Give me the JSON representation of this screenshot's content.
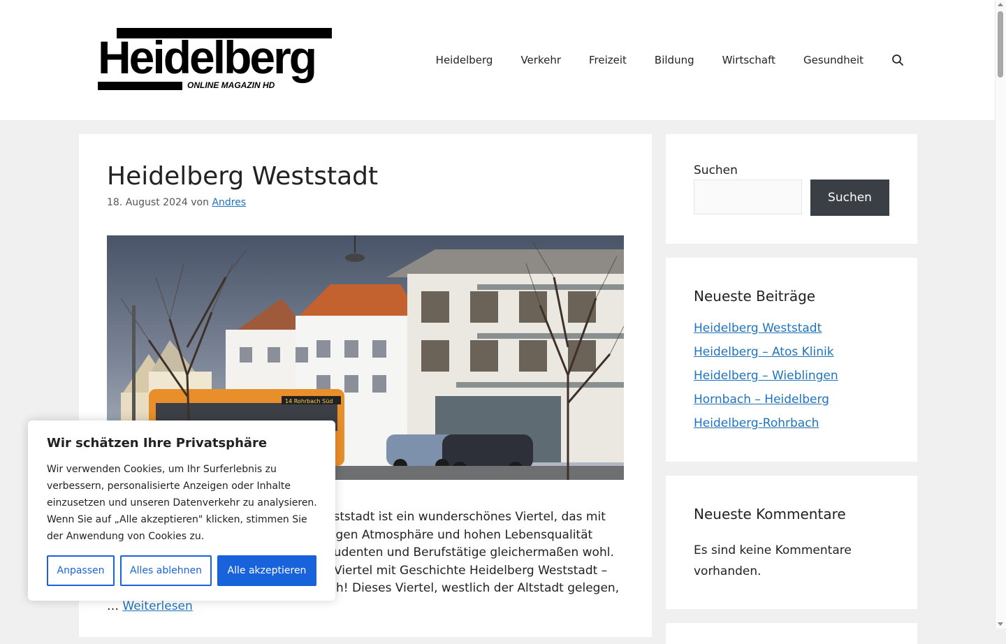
{
  "header": {
    "logo": {
      "word": "Heidelberg",
      "subtitle": "ONLINE MAGAZIN HD"
    },
    "nav": [
      "Heidelberg",
      "Verkehr",
      "Freizeit",
      "Bildung",
      "Wirtschaft",
      "Gesundheit"
    ],
    "search_icon": "search-icon"
  },
  "article": {
    "title": "Heidelberg Weststadt",
    "date": "18. August 2024",
    "by": "von",
    "author": "Andres",
    "excerpt_lines": [
      "eststadt ist ein wunderschönes Viertel, das mit",
      "ligen Atmosphäre und hohen Lebensqualität",
      "tudenten und Berufstätige gleichermaßen wohl.",
      "Viertel mit Geschichte Heidelberg Weststadt –",
      "h! Dieses Viertel, westlich der Altstadt gelegen,"
    ],
    "ellipsis": "…",
    "read_more": "Weiterlesen",
    "image_tram_label": "14 Rohrbach Süd"
  },
  "sidebar": {
    "search": {
      "label": "Suchen",
      "placeholder": "",
      "button": "Suchen"
    },
    "recent_posts": {
      "title": "Neueste Beiträge",
      "items": [
        "Heidelberg Weststadt",
        "Heidelberg – Atos Klinik",
        "Heidelberg – Wieblingen",
        "Hornbach – Heidelberg",
        "Heidelberg-Rohrbach"
      ]
    },
    "recent_comments": {
      "title": "Neueste Kommentare",
      "text": "Es sind keine Kommentare vorhanden."
    }
  },
  "cookie": {
    "title": "Wir schätzen Ihre Privatsphäre",
    "text": "Wir verwenden Cookies, um Ihr Surferlebnis zu verbessern, personalisierte Anzeigen oder Inhalte einzusetzen und unseren Datenverkehr zu analysieren. Wenn Sie auf „Alle akzeptieren\" klicken, stimmen Sie der Anwendung von Cookies zu.",
    "buttons": {
      "customize": "Anpassen",
      "reject": "Alles ablehnen",
      "accept": "Alle akzeptieren"
    }
  },
  "colors": {
    "link": "#1e73be",
    "page_bg": "#f0f0f0",
    "search_button_bg": "#3a3f45",
    "cookie_accent": "#1863dc"
  }
}
